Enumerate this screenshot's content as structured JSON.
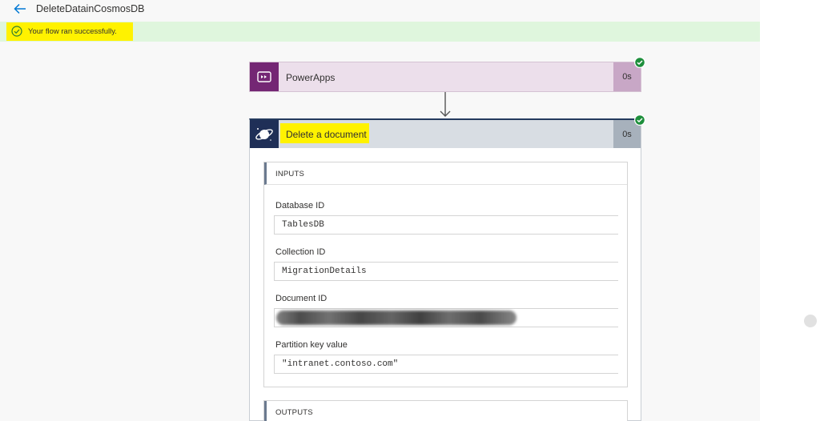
{
  "header": {
    "flow_name": "DeleteDatainCosmosDB",
    "back_icon": "back-arrow-icon"
  },
  "status_banner": {
    "message": "Your flow ran successfully.",
    "icon": "success-check-icon",
    "highlight_color": "#fff200"
  },
  "steps": [
    {
      "title": "PowerApps",
      "duration": "0s",
      "icon": "powerapps-logo-icon",
      "status_icon": "success-check-icon",
      "accent_color": "#742774"
    },
    {
      "title": "Delete a document",
      "duration": "0s",
      "icon": "cosmosdb-planet-icon",
      "status_icon": "success-check-icon",
      "accent_color": "#1f2f57",
      "inputs_label": "INPUTS",
      "outputs_label": "OUTPUTS",
      "fields": [
        {
          "label": "Database ID",
          "value": "TablesDB"
        },
        {
          "label": "Collection ID",
          "value": "MigrationDetails"
        },
        {
          "label": "Document ID",
          "value": "",
          "redacted": true
        },
        {
          "label": "Partition key value",
          "value": "\"intranet.contoso.com\""
        }
      ]
    }
  ],
  "colors": {
    "success_banner": "#dff6dd",
    "success_check": "#1e8f3c",
    "powerapps_card": "#ecdfeb",
    "action_header": "#d8dde3"
  }
}
